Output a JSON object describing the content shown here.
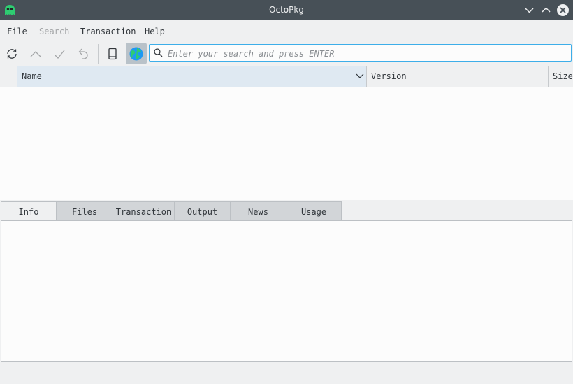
{
  "window": {
    "title": "OctoPkg",
    "app_icon": "octopkg-ghost-icon",
    "controls": [
      "minimize-icon",
      "maximize-icon",
      "close-icon"
    ]
  },
  "menubar": {
    "items": [
      {
        "label": "File",
        "enabled": true
      },
      {
        "label": "Search",
        "enabled": false
      },
      {
        "label": "Transaction",
        "enabled": true
      },
      {
        "label": "Help",
        "enabled": true
      }
    ]
  },
  "toolbar": {
    "buttons": [
      "sync-icon",
      "commit-up-icon",
      "apply-check-icon",
      "undo-icon",
      "device-icon",
      "remote-globe-icon"
    ],
    "active": "remote-globe-icon"
  },
  "search": {
    "placeholder": "Enter your search and press ENTER",
    "value": ""
  },
  "table": {
    "columns": [
      "",
      "Name",
      "Version",
      "Size"
    ],
    "rows": []
  },
  "tabs": {
    "items": [
      "Info",
      "Files",
      "Transaction",
      "Output",
      "News",
      "Usage"
    ],
    "active": "Info"
  },
  "colors": {
    "titlebar": "#475057",
    "accent": "#3daee9",
    "icon_green": "#2ecc71"
  }
}
